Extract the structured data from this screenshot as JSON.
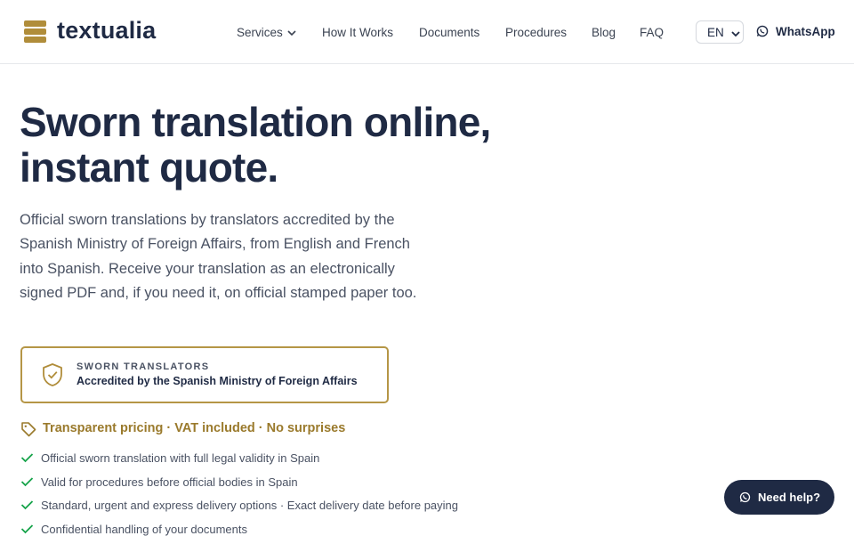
{
  "header": {
    "brand": "textualia",
    "nav": {
      "services": "Services",
      "how_it_works": "How It Works",
      "documents": "Documents",
      "procedures": "Procedures",
      "blog": "Blog",
      "faq": "FAQ"
    },
    "language": "EN",
    "whatsapp": "WhatsApp"
  },
  "hero": {
    "title_line1": "Sworn translation online,",
    "title_line2": "instant quote.",
    "lead": "Official sworn translations by translators accredited by the Spanish Ministry of Foreign Affairs, from English and French into Spanish. Receive your translation as an electronically signed PDF and, if you need it, on official stamped paper too."
  },
  "badge": {
    "kicker": "SWORN TRANSLATORS",
    "title": "Accredited by the Spanish Ministry of Foreign Affairs"
  },
  "pricing": "Transparent pricing · VAT included · No surprises",
  "features": [
    "Official sworn translation with full legal validity in Spain",
    "Valid for procedures before official bodies in Spain",
    "Standard, urgent and express delivery options · Exact delivery date before paying",
    "Confidential handling of your documents"
  ],
  "help_button": "Need help?",
  "colors": {
    "navy": "#1f2a44",
    "gold": "#b08d3a",
    "check_green": "#16a34a"
  },
  "icons": [
    "logo-icon",
    "chevron-down-icon",
    "whatsapp-icon",
    "shield-check-icon",
    "tag-icon",
    "check-icon",
    "chat-icon"
  ]
}
